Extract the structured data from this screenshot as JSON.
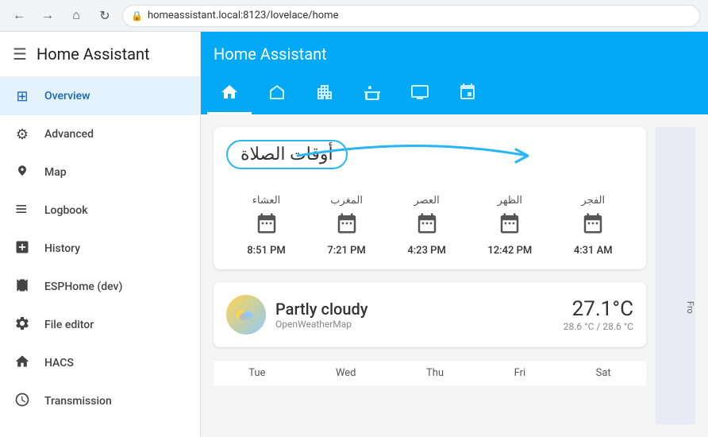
{
  "browser": {
    "url": "homeassistant.local:8123/lovelace/home",
    "back_icon": "←",
    "forward_icon": "→",
    "home_icon": "⌂",
    "refresh_icon": "↻",
    "lock_icon": "🔒"
  },
  "sidebar": {
    "title": "Home Assistant",
    "hamburger": "☰",
    "items": [
      {
        "id": "overview",
        "label": "Overview",
        "icon": "⊞",
        "active": true
      },
      {
        "id": "advanced",
        "label": "Advanced",
        "icon": "⚙",
        "active": false
      },
      {
        "id": "map",
        "label": "Map",
        "icon": "👤",
        "active": false
      },
      {
        "id": "logbook",
        "label": "Logbook",
        "icon": "☰",
        "active": false
      },
      {
        "id": "history",
        "label": "History",
        "icon": "📊",
        "active": false
      },
      {
        "id": "esphome",
        "label": "ESPHome (dev)",
        "icon": "🎞",
        "active": false
      },
      {
        "id": "file-editor",
        "label": "File editor",
        "icon": "🔧",
        "active": false
      },
      {
        "id": "hacs",
        "label": "HACS",
        "icon": "🏠",
        "active": false
      },
      {
        "id": "transmission",
        "label": "Transmission",
        "icon": "🕐",
        "active": false
      }
    ]
  },
  "topbar": {
    "title": "Home Assistant"
  },
  "tabs": [
    {
      "id": "overview",
      "icon": "⌂",
      "active": true
    },
    {
      "id": "home",
      "icon": "🏠",
      "active": false
    },
    {
      "id": "building",
      "icon": "🏗",
      "active": false
    },
    {
      "id": "bath",
      "icon": "🛁",
      "active": false
    },
    {
      "id": "monitor",
      "icon": "🖥",
      "active": false
    },
    {
      "id": "network",
      "icon": "⊞",
      "active": false
    }
  ],
  "prayer_card": {
    "title": "أوقات الصلاة",
    "times": [
      {
        "name": "العشاء",
        "time": "8:51 PM"
      },
      {
        "name": "المغرب",
        "time": "7:21 PM"
      },
      {
        "name": "العصر",
        "time": "4:23 PM"
      },
      {
        "name": "الظهر",
        "time": "12:42 PM"
      },
      {
        "name": "الفجر",
        "time": "4:31 AM"
      }
    ]
  },
  "weather_card": {
    "condition": "Partly cloudy",
    "source": "OpenWeatherMap",
    "temperature": "27.1°C",
    "range": "28.6 °C / 28.6 °C",
    "days": [
      "Tue",
      "Wed",
      "Thu",
      "Fri",
      "Sat"
    ]
  },
  "right_panel": {
    "label": "Fro"
  }
}
